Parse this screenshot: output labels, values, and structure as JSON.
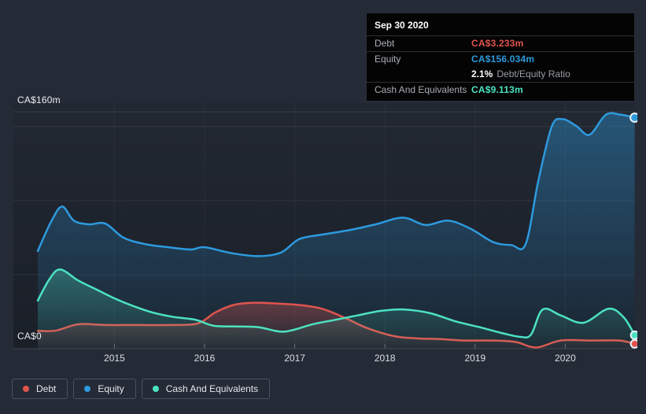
{
  "page": {
    "background": "#252b36"
  },
  "tooltip": {
    "date": "Sep 30 2020",
    "rows": {
      "debt": {
        "label": "Debt",
        "value": "CA$3.233m"
      },
      "equity": {
        "label": "Equity",
        "value": "CA$156.034m"
      },
      "ratio": {
        "value": "2.1%",
        "label": "Debt/Equity Ratio"
      },
      "cash": {
        "label": "Cash And Equivalents",
        "value": "CA$9.113m"
      }
    }
  },
  "legend": {
    "items": [
      {
        "label": "Debt",
        "color": "#e0544e"
      },
      {
        "label": "Equity",
        "color": "#2d9ade"
      },
      {
        "label": "Cash And Equivalents",
        "color": "#4ce2c1"
      }
    ]
  },
  "chart_data": {
    "type": "area",
    "title": "",
    "xlabel": "",
    "ylabel": "",
    "unit": "CA$ millions",
    "grid": true,
    "legend_position": "bottom",
    "x_range": [
      2014.15,
      2020.77
    ],
    "x_ticks": [
      "2015",
      "2016",
      "2017",
      "2018",
      "2019",
      "2020"
    ],
    "ylim": [
      0,
      160
    ],
    "y_gridline_values_m": [
      160,
      150,
      100,
      50,
      0
    ],
    "y_axis_labels": {
      "max": "CA$160m",
      "zero": "CA$0"
    },
    "highlight_point": {
      "date": "Sep 30 2020",
      "debt_m": 3.233,
      "equity_m": 156.034,
      "cash_m": 9.113,
      "debt_equity_ratio_pct": 2.1
    },
    "series": [
      {
        "name": "Debt",
        "color": "#e0544e",
        "points": [
          [
            2014.15,
            12
          ],
          [
            2014.35,
            12.2
          ],
          [
            2014.6,
            16.5
          ],
          [
            2014.9,
            16
          ],
          [
            2015.25,
            16
          ],
          [
            2015.6,
            16
          ],
          [
            2015.92,
            17
          ],
          [
            2016.12,
            24.5
          ],
          [
            2016.32,
            29.5
          ],
          [
            2016.55,
            31
          ],
          [
            2016.8,
            30.5
          ],
          [
            2017.05,
            29.5
          ],
          [
            2017.3,
            27
          ],
          [
            2017.55,
            21
          ],
          [
            2017.8,
            14
          ],
          [
            2018.1,
            8.5
          ],
          [
            2018.35,
            7
          ],
          [
            2018.6,
            6.5
          ],
          [
            2018.9,
            5.5
          ],
          [
            2019.2,
            5.5
          ],
          [
            2019.45,
            4.5
          ],
          [
            2019.68,
            0.8
          ],
          [
            2019.95,
            5.5
          ],
          [
            2020.3,
            5.5
          ],
          [
            2020.6,
            5.5
          ],
          [
            2020.77,
            3.233
          ]
        ]
      },
      {
        "name": "Equity",
        "color": "#2d9ade",
        "points": [
          [
            2014.15,
            66
          ],
          [
            2014.3,
            86
          ],
          [
            2014.42,
            96
          ],
          [
            2014.55,
            86.5
          ],
          [
            2014.72,
            84
          ],
          [
            2014.9,
            84.5
          ],
          [
            2015.1,
            75
          ],
          [
            2015.35,
            70.5
          ],
          [
            2015.6,
            68.5
          ],
          [
            2015.85,
            67
          ],
          [
            2016.0,
            68.5
          ],
          [
            2016.3,
            64.5
          ],
          [
            2016.6,
            62.5
          ],
          [
            2016.85,
            65
          ],
          [
            2017.05,
            74
          ],
          [
            2017.3,
            77
          ],
          [
            2017.6,
            80
          ],
          [
            2017.9,
            84
          ],
          [
            2018.2,
            88.5
          ],
          [
            2018.45,
            83.5
          ],
          [
            2018.7,
            86.5
          ],
          [
            2018.95,
            81
          ],
          [
            2019.2,
            72
          ],
          [
            2019.4,
            70
          ],
          [
            2019.56,
            70.5
          ],
          [
            2019.7,
            113
          ],
          [
            2019.85,
            150
          ],
          [
            2019.97,
            155
          ],
          [
            2020.12,
            150.5
          ],
          [
            2020.27,
            144.5
          ],
          [
            2020.45,
            158
          ],
          [
            2020.62,
            158
          ],
          [
            2020.77,
            156.034
          ]
        ]
      },
      {
        "name": "Cash And Equivalents",
        "color": "#4ce2c1",
        "points": [
          [
            2014.15,
            32.5
          ],
          [
            2014.28,
            47
          ],
          [
            2014.4,
            53.5
          ],
          [
            2014.6,
            46
          ],
          [
            2014.8,
            40
          ],
          [
            2015.0,
            34
          ],
          [
            2015.2,
            29
          ],
          [
            2015.42,
            24.5
          ],
          [
            2015.65,
            21.5
          ],
          [
            2015.9,
            19.5
          ],
          [
            2016.1,
            15.5
          ],
          [
            2016.35,
            15
          ],
          [
            2016.6,
            14.5
          ],
          [
            2016.88,
            11.5
          ],
          [
            2017.2,
            16.5
          ],
          [
            2017.45,
            19.5
          ],
          [
            2017.7,
            22.5
          ],
          [
            2017.95,
            25.5
          ],
          [
            2018.2,
            26.5
          ],
          [
            2018.5,
            24
          ],
          [
            2018.78,
            18.5
          ],
          [
            2019.05,
            14.5
          ],
          [
            2019.3,
            10.5
          ],
          [
            2019.5,
            8
          ],
          [
            2019.62,
            9.5
          ],
          [
            2019.75,
            26.5
          ],
          [
            2019.95,
            22.5
          ],
          [
            2020.2,
            17.5
          ],
          [
            2020.48,
            27
          ],
          [
            2020.65,
            21
          ],
          [
            2020.77,
            9.113
          ]
        ]
      }
    ]
  }
}
